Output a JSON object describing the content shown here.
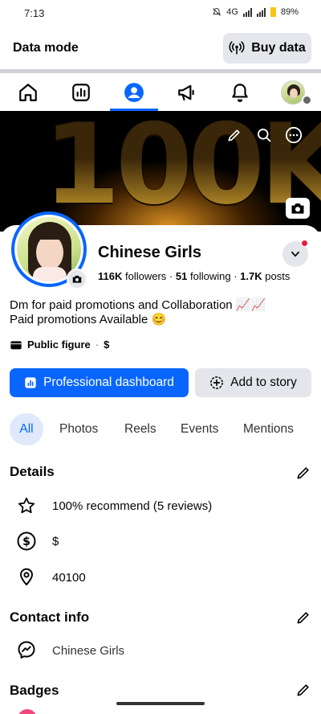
{
  "status_bar": {
    "time": "7:13",
    "network": "4G",
    "battery": "89%"
  },
  "data_mode": {
    "label": "Data mode",
    "buy_button": "Buy data"
  },
  "nav": {
    "items": [
      "home-icon",
      "dashboard-icon",
      "profile-icon",
      "megaphone-icon",
      "bell-icon",
      "avatar"
    ],
    "active": "profile-icon"
  },
  "cover": {
    "text": "100K",
    "icons": [
      "pencil-icon",
      "search-icon",
      "more-icon",
      "camera-icon"
    ]
  },
  "profile": {
    "name": "Chinese Girls",
    "followers_count": "116K",
    "followers_label": "followers",
    "following_count": "51",
    "following_label": "following",
    "posts_count": "1.7K",
    "posts_label": "posts",
    "bio_line1": "Dm for paid promotions and Collaboration 📈📈",
    "bio_line2": "Paid promotions Available 😊",
    "category": "Public figure",
    "price": "$",
    "separator": "·"
  },
  "buttons": {
    "dashboard": "Professional dashboard",
    "add_story": "Add to story"
  },
  "tabs": [
    "All",
    "Photos",
    "Reels",
    "Events",
    "Mentions"
  ],
  "details": {
    "title": "Details",
    "items": [
      {
        "icon": "star-icon",
        "text": "100% recommend (5 reviews)"
      },
      {
        "icon": "dollar-icon",
        "text": "$"
      },
      {
        "icon": "location-icon",
        "text": "40100"
      }
    ]
  },
  "contact": {
    "title": "Contact info",
    "items": [
      {
        "icon": "messenger-icon",
        "text": "Chinese Girls"
      }
    ]
  },
  "badges": {
    "title": "Badges"
  },
  "colors": {
    "accent": "#0866ff",
    "button_gray": "#e4e6eb",
    "notification_dot": "#e41e3f"
  }
}
